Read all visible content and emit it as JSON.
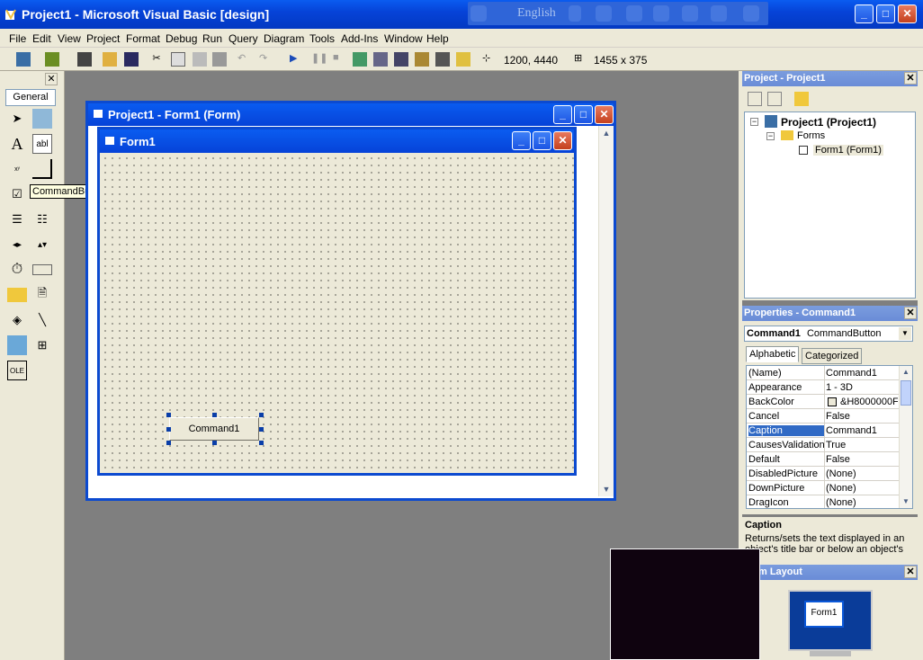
{
  "window": {
    "title": "Project1 - Microsoft Visual Basic [design]",
    "language": "English",
    "minimize": "_",
    "maximize": "□",
    "close": "✕"
  },
  "menu": [
    "File",
    "Edit",
    "View",
    "Project",
    "Format",
    "Debug",
    "Run",
    "Query",
    "Diagram",
    "Tools",
    "Add-Ins",
    "Window",
    "Help"
  ],
  "toolbar": {
    "position_readout": "1200, 4440",
    "size_readout": "1455 x 375"
  },
  "toolbox": {
    "tab_label": "General",
    "tooltip": "CommandButton",
    "close": "✕"
  },
  "project_window": {
    "title": "Project1 - Form1 (Form)"
  },
  "form": {
    "title": "Form1",
    "button_caption": "Command1"
  },
  "project_explorer": {
    "title": "Project - Project1",
    "close": "✕",
    "tree": {
      "root": "Project1 (Project1)",
      "folder": "Forms",
      "item": "Form1 (Form1)"
    }
  },
  "properties": {
    "title": "Properties - Command1",
    "close": "✕",
    "object_name": "Command1",
    "object_type": "CommandButton",
    "tab_alphabetic": "Alphabetic",
    "tab_categorized": "Categorized",
    "rows": [
      {
        "name": "(Name)",
        "value": "Command1"
      },
      {
        "name": "Appearance",
        "value": "1 - 3D"
      },
      {
        "name": "BackColor",
        "value": "&H8000000F"
      },
      {
        "name": "Cancel",
        "value": "False"
      },
      {
        "name": "Caption",
        "value": "Command1"
      },
      {
        "name": "CausesValidation",
        "value": "True"
      },
      {
        "name": "Default",
        "value": "False"
      },
      {
        "name": "DisabledPicture",
        "value": "(None)"
      },
      {
        "name": "DownPicture",
        "value": "(None)"
      },
      {
        "name": "DragIcon",
        "value": "(None)"
      }
    ],
    "selected_row": "Caption"
  },
  "description": {
    "heading": "Caption",
    "text": "Returns/sets the text displayed in an object's title bar or below an object's"
  },
  "form_layout": {
    "title": "m Layout",
    "close": "✕",
    "preview_label": "Form1"
  },
  "colors": {
    "titlebar": "#0643d8",
    "panel_title": "#7a9cde",
    "selection": "#316ac5",
    "workspace": "#7f7f7f"
  }
}
